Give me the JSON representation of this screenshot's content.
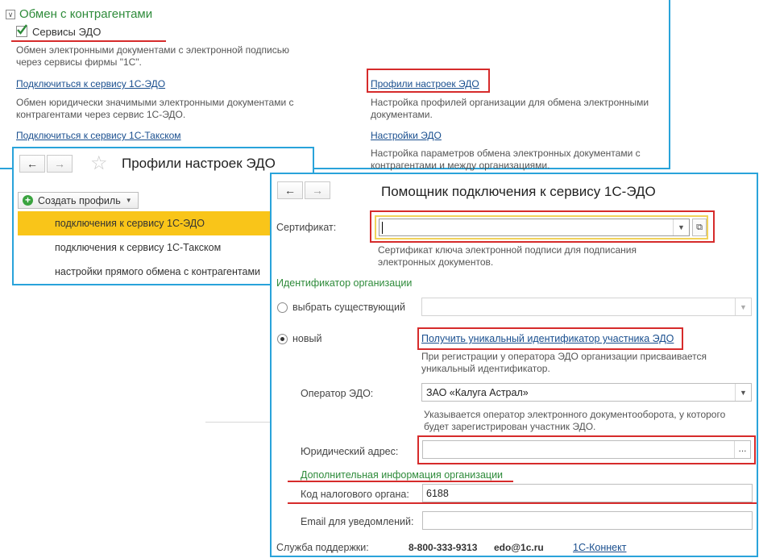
{
  "settings": {
    "section_title": "Обмен с контрагентами",
    "edo_checkbox_label": "Сервисы ЭДО",
    "edo_description": "Обмен электронными документами с электронной подписью\nчерез сервисы фирмы \"1С\".",
    "connect_1c_edo": "Подключиться к сервису 1С-ЭДО",
    "connect_1c_edo_desc": "Обмен юридически значимыми электронными документами с\nконтрагентами через сервис 1С-ЭДО.",
    "connect_taxcom": "Подключиться к сервису 1С-Такском",
    "profiles_link": "Профили настроек ЭДО",
    "profiles_desc": "Настройка профилей организации для обмена электронными\nдокументами.",
    "settings_link": "Настройки ЭДО",
    "settings_desc": "Настройка параметров обмена электронных документами с\nконтрагентами и между организациями."
  },
  "profiles": {
    "title": "Профили настроек ЭДО",
    "create_button": "Создать профиль",
    "items": [
      "подключения к сервису 1С-ЭДО",
      "подключения к сервису 1С-Такском",
      "настройки прямого обмена с контрагентами"
    ]
  },
  "wizard": {
    "title": "Помощник подключения к сервису 1С-ЭДО",
    "certificate_label": "Сертификат:",
    "certificate_desc": "Сертификат ключа электронной подписи для подписания\nэлектронных документов.",
    "org_id_heading": "Идентификатор организации",
    "option_existing": "выбрать существующий",
    "option_new": "новый",
    "get_id_link": "Получить уникальный идентификатор участника ЭДО",
    "get_id_desc": "При регистрации у оператора ЭДО организации присваивается\nуникальный идентификатор.",
    "operator_label": "Оператор ЭДО:",
    "operator_value": "ЗАО «Калуга Астрал»",
    "operator_desc": "Указывается оператор электронного документооборота, у которого\nбудет зарегистрирован участник ЭДО.",
    "legal_address_label": "Юридический адрес:",
    "legal_address_button": "...",
    "extra_info_heading": "Дополнительная информация организации",
    "tax_code_label": "Код налогового органа:",
    "tax_code_value": "6188",
    "email_label": "Email для уведомлений:",
    "support_label": "Служба поддержки:",
    "support_phone": "8-800-333-9313",
    "support_email": "edo@1c.ru",
    "support_link": "1С-Коннект"
  },
  "icons": {
    "back": "arrow-left-icon",
    "forward": "arrow-right-icon",
    "favorite": "star-icon",
    "add": "plus-circle-icon",
    "collapse": "collapse-icon",
    "check": "checkbox-icon",
    "dropdown": "chevron-down-icon",
    "open": "open-icon"
  },
  "colors": {
    "accent_border": "#29a3da",
    "highlight": "#d62b2b",
    "selected_row": "#f9c519",
    "section_green": "#2e8b3a"
  }
}
